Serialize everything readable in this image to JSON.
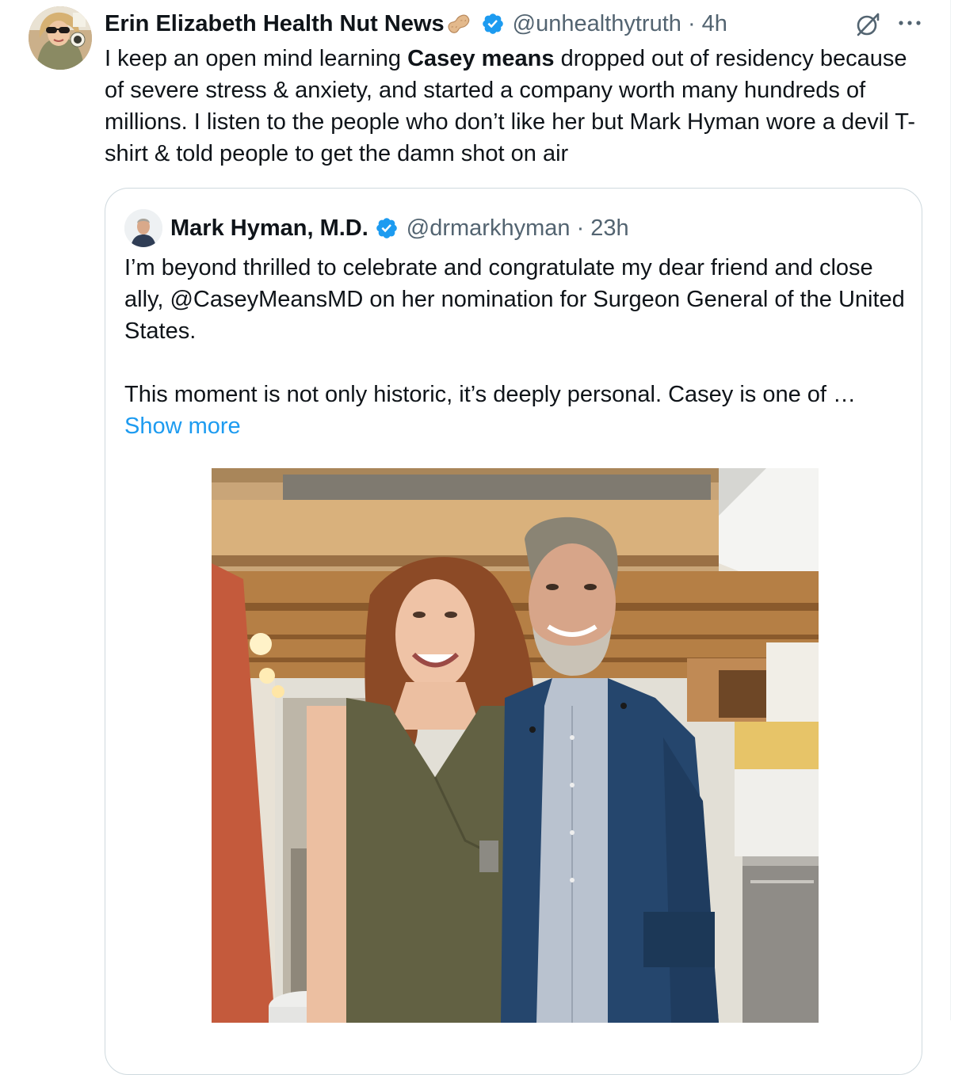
{
  "tweet": {
    "author_name": "Erin Elizabeth Health Nut News",
    "name_emoji": "peanut-emoji",
    "handle": "@unhealthytruth",
    "separator": " · ",
    "time": "4h",
    "body_before": "I keep an open mind learning ",
    "body_bold": "Casey means",
    "body_after": " dropped out of residency because of severe stress & anxiety, and started a company worth many hundreds of millions. I listen to the people who don’t like her but Mark Hyman wore  a devil T-shirt &  told people to get the damn shot on air",
    "icons": {
      "verified": "verified-badge-icon",
      "grok": "grok-icon",
      "more": "more-icon"
    }
  },
  "quote": {
    "author_name": "Mark Hyman, M.D.",
    "handle": "@drmarkhyman",
    "separator": " · ",
    "time": "23h",
    "paragraph_1": "I’m beyond thrilled to celebrate and congratulate my dear friend and close ally, @CaseyMeansMD  on her nomination for Surgeon General of the United States.",
    "paragraph_2": "This moment is not only historic, it’s deeply personal. Casey is one of …",
    "show_more": "Show more",
    "photo": "two-people-posing-in-kitchen-photo"
  },
  "colors": {
    "text": "#0f1419",
    "secondary": "#536471",
    "link": "#1d9bf0",
    "verified": "#1d9bf0",
    "border": "#cfd9de"
  }
}
